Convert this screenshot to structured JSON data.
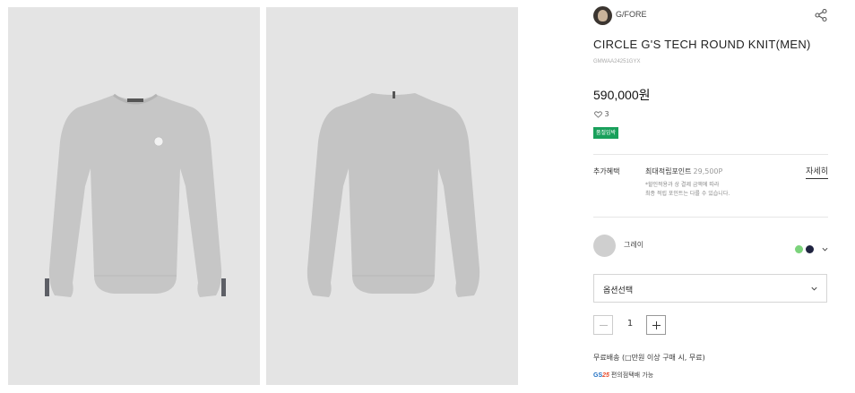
{
  "gallery": {
    "images": [
      {
        "view": "front",
        "product_color": "#c4c4c4"
      },
      {
        "view": "back",
        "product_color": "#c4c4c4"
      }
    ]
  },
  "brand": {
    "name": "G/FORE"
  },
  "product": {
    "title": "CIRCLE G'S TECH ROUND KNIT(MEN)",
    "code": "GMWAA24251GYX",
    "price": "590,000원",
    "likes": "3",
    "badge": "품절임박",
    "badge_color": "#19a05b"
  },
  "benefit": {
    "label": "추가혜택",
    "points_label": "최대적립포인트",
    "points_value": "29,500P",
    "detail_link": "자세히",
    "note_line1": "*할인적용과 상 결제 금액에 따라",
    "note_line2": "최종 적립 포인트는 다를 수 있습니다."
  },
  "color": {
    "selected_name": "그레이",
    "options": [
      {
        "name": "green",
        "hex": "#7bd37b"
      },
      {
        "name": "navy",
        "hex": "#1f2340"
      }
    ]
  },
  "option": {
    "placeholder": "옵션선택"
  },
  "quantity": {
    "value": "1"
  },
  "shipping": {
    "text": "무료배송 (□만원 이상 구매 시, 무료)"
  },
  "pickup": {
    "logo_prefix": "GS",
    "logo_suffix": "25",
    "text": "편의점택배 가능"
  },
  "icons": [
    "share-icon",
    "heart-icon",
    "chevron-down-icon",
    "minus-icon",
    "plus-icon"
  ]
}
